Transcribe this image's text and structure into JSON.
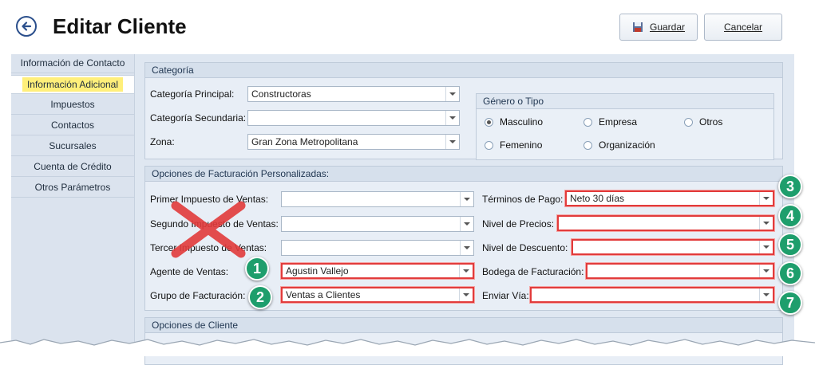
{
  "header": {
    "title": "Editar Cliente",
    "save_label": "Guardar",
    "cancel_label": "Cancelar"
  },
  "sidebar": {
    "items": [
      {
        "label": "Información de Contacto",
        "active": false
      },
      {
        "label": "Información Adicional",
        "active": true
      },
      {
        "label": "Impuestos",
        "active": false
      },
      {
        "label": "Contactos",
        "active": false
      },
      {
        "label": "Sucursales",
        "active": false
      },
      {
        "label": "Cuenta de Crédito",
        "active": false
      },
      {
        "label": "Otros Parámetros",
        "active": false
      }
    ]
  },
  "categoria": {
    "heading": "Categoría",
    "principal_label": "Categoría Principal:",
    "principal_value": "Constructoras",
    "secundaria_label": "Categoría Secundaria:",
    "secundaria_value": "",
    "zona_label": "Zona:",
    "zona_value": "Gran Zona Metropolitana",
    "genero": {
      "heading": "Género o Tipo",
      "options": [
        {
          "label": "Masculino",
          "selected": true
        },
        {
          "label": "Empresa",
          "selected": false
        },
        {
          "label": "Otros",
          "selected": false
        },
        {
          "label": "Femenino",
          "selected": false
        },
        {
          "label": "Organización",
          "selected": false
        }
      ]
    }
  },
  "facturacion": {
    "heading": "Opciones de Facturación Personalizadas:",
    "left": [
      {
        "label": "Primer Impuesto de Ventas:",
        "value": ""
      },
      {
        "label": "Segundo Impuesto de Ventas:",
        "value": ""
      },
      {
        "label": "Tercer Impuesto de Ventas:",
        "value": ""
      },
      {
        "label": "Agente de Ventas:",
        "value": "Agustin Vallejo"
      },
      {
        "label": "Grupo de Facturación:",
        "value": "Ventas a Clientes"
      }
    ],
    "right": [
      {
        "label": "Términos de Pago:",
        "value": "Neto 30 días"
      },
      {
        "label": "Nivel de Precios:",
        "value": ""
      },
      {
        "label": "Nivel de Descuento:",
        "value": ""
      },
      {
        "label": "Bodega de Facturación:",
        "value": ""
      },
      {
        "label": "Enviar Vía:",
        "value": ""
      }
    ]
  },
  "opciones_cliente": {
    "heading": "Opciones de Cliente"
  },
  "badges": [
    "1",
    "2",
    "3",
    "4",
    "5",
    "6",
    "7"
  ],
  "colors": {
    "highlight": "#ffef7a",
    "callout_red": "#e23b3b",
    "badge_green": "#1e9e6c",
    "panel": "#dfe7f1"
  }
}
